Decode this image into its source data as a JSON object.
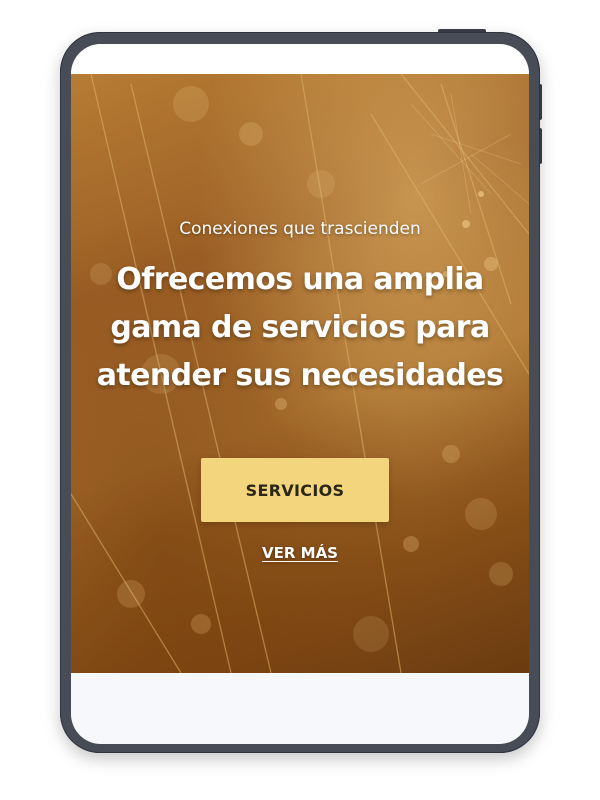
{
  "hero": {
    "eyebrow": "Conexiones que trascienden",
    "headline_lines": [
      "Ofrecemos una amplia",
      "gama de servicios para",
      "atender sus necesidades"
    ],
    "primary_button_label": "SERVICIOS",
    "secondary_link_label": "VER MÁS"
  },
  "colors": {
    "device_frame": "#474c57",
    "screen_background": "#f6f8fb",
    "hero_gold": "#b97d35",
    "button_background": "#f2d57c",
    "button_text": "#2b2617",
    "text_light": "#ffffff"
  }
}
